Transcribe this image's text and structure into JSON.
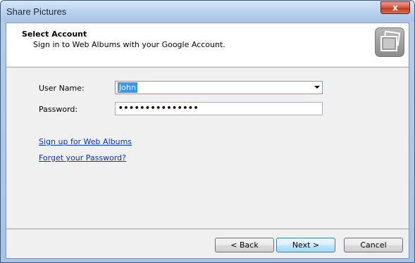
{
  "window": {
    "title": "Share Pictures",
    "close_glyph": "x"
  },
  "header": {
    "title": "Select Account",
    "subtitle": "Sign in to Web Albums with your Google Account.",
    "icon": "photos-stack-icon"
  },
  "form": {
    "username_label": "User Name:",
    "username_value": "John",
    "password_label": "Password:",
    "password_mask": "•••••••••••••••"
  },
  "links": {
    "signup": "Sign up for Web Albums",
    "forgot": "Forget your Password?"
  },
  "buttons": {
    "back": "< Back",
    "next": "Next >",
    "cancel": "Cancel"
  }
}
